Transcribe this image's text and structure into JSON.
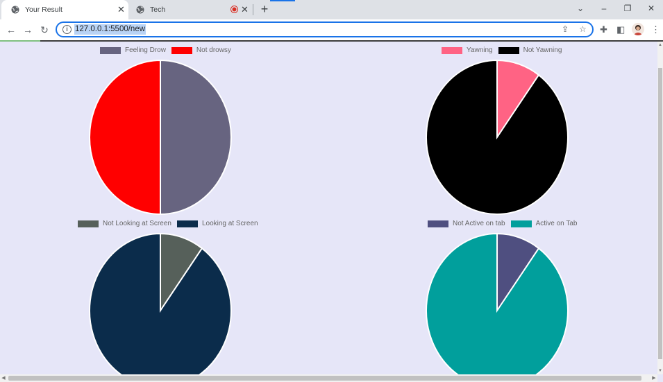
{
  "tabs": [
    {
      "title": "Your Result",
      "active": true,
      "icon": "globe-icon"
    },
    {
      "title": "Tech",
      "active": false,
      "icon": "globe-icon",
      "recording": true
    }
  ],
  "address_bar": {
    "url": "127.0.0.1:5500/new"
  },
  "window_controls": {
    "tab_search": "⌄",
    "minimize": "–",
    "restore": "❐",
    "close": "✕"
  },
  "charts": [
    {
      "id": "drowsy",
      "legend": [
        {
          "label": "Feeling Drow",
          "color": "#676480"
        },
        {
          "label": "Not drowsy",
          "color": "#ff0000"
        }
      ]
    },
    {
      "id": "yawning",
      "legend": [
        {
          "label": "Yawning",
          "color": "#ff6384"
        },
        {
          "label": "Not Yawning",
          "color": "#000000"
        }
      ]
    },
    {
      "id": "screen",
      "legend": [
        {
          "label": "Not Looking at Screen",
          "color": "#56605a"
        },
        {
          "label": "Looking at Screen",
          "color": "#0b2c4b"
        }
      ]
    },
    {
      "id": "tab",
      "legend": [
        {
          "label": "Not Active on tab",
          "color": "#4f4f80"
        },
        {
          "label": "Active on Tab",
          "color": "#019f9c"
        }
      ]
    }
  ],
  "chart_data": [
    {
      "type": "pie",
      "categories": [
        "Feeling Drow",
        "Not drowsy"
      ],
      "values": [
        50,
        50
      ],
      "colors": [
        "#676480",
        "#ff0000"
      ]
    },
    {
      "type": "pie",
      "categories": [
        "Yawning",
        "Not Yawning"
      ],
      "values": [
        10,
        90
      ],
      "colors": [
        "#ff6384",
        "#000000"
      ]
    },
    {
      "type": "pie",
      "categories": [
        "Not Looking at Screen",
        "Looking at Screen"
      ],
      "values": [
        10,
        90
      ],
      "colors": [
        "#56605a",
        "#0b2c4b"
      ]
    },
    {
      "type": "pie",
      "categories": [
        "Not Active on tab",
        "Active on Tab"
      ],
      "values": [
        10,
        90
      ],
      "colors": [
        "#4f4f80",
        "#019f9c"
      ]
    }
  ]
}
